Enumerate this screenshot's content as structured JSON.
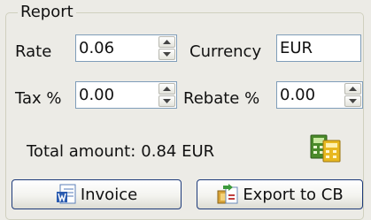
{
  "group": {
    "title": "Report"
  },
  "rate": {
    "label": "Rate",
    "value": "0.06"
  },
  "currency": {
    "label": "Currency",
    "value": "EUR"
  },
  "tax": {
    "label": "Tax %",
    "value": "0.00"
  },
  "rebate": {
    "label": "Rebate %",
    "value": "0.00"
  },
  "total": {
    "label": "Total amount:",
    "value": "0.84 EUR"
  },
  "buttons": {
    "invoice": "Invoice",
    "export": "Export to CB"
  },
  "icons": {
    "calculator": "calculator-icon",
    "invoice": "word-document-icon",
    "export": "export-icon",
    "spin_up": "arrow-up-icon",
    "spin_down": "arrow-down-icon"
  },
  "colors": {
    "background": "#ecebe6",
    "field_border": "#7f9db9",
    "button_border": "#1d3a7a",
    "group_border": "#d0d0bf"
  }
}
